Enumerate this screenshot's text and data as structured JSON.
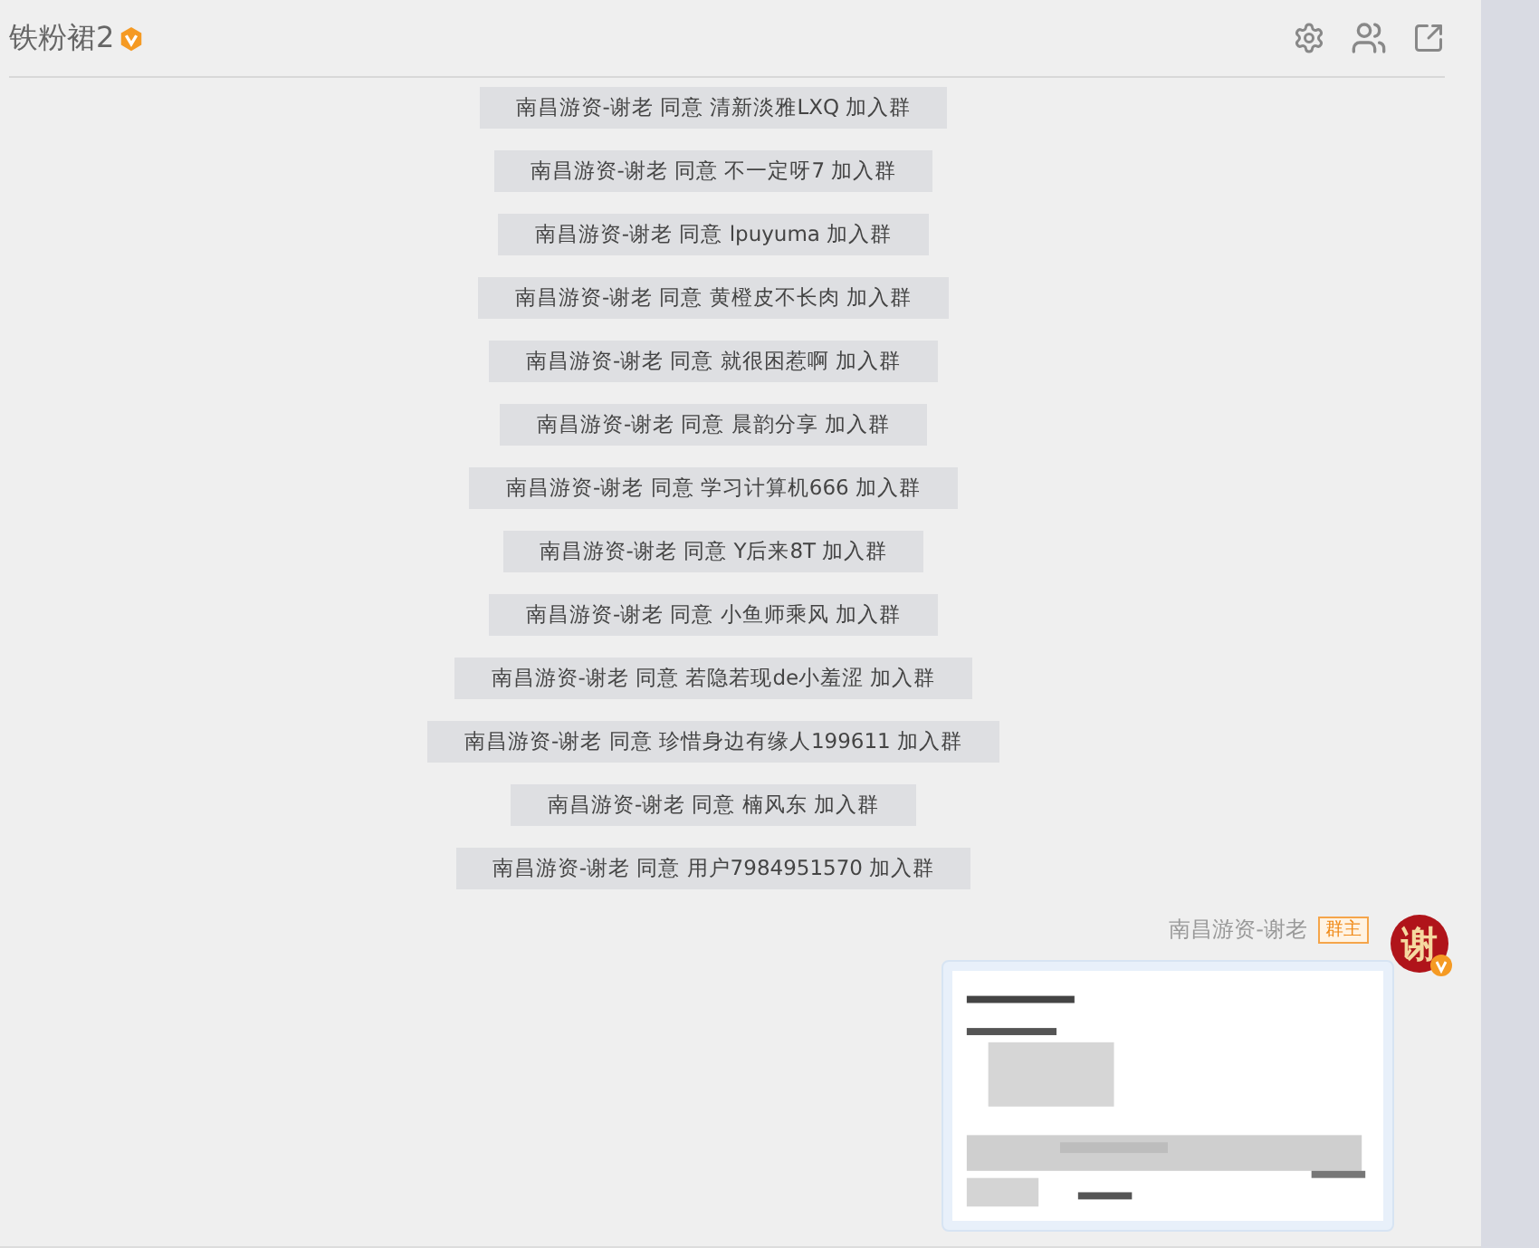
{
  "window": {
    "title": "铁粉裙2"
  },
  "notices": [
    "南昌游资-谢老 同意 清新淡雅LXQ 加入群",
    "南昌游资-谢老 同意 不一定呀7 加入群",
    "南昌游资-谢老 同意 lpuyuma 加入群",
    "南昌游资-谢老 同意 黄橙皮不长肉 加入群",
    "南昌游资-谢老 同意 就很困惹啊 加入群",
    "南昌游资-谢老 同意 晨韵分享 加入群",
    "南昌游资-谢老 同意 学习计算机666 加入群",
    "南昌游资-谢老 同意 Y后来8T 加入群",
    "南昌游资-谢老 同意 小鱼师乘风 加入群",
    "南昌游资-谢老 同意 若隐若现de小羞涩 加入群",
    "南昌游资-谢老 同意 珍惜身边有缘人199611 加入群",
    "南昌游资-谢老 同意 楠风东 加入群",
    "南昌游资-谢老 同意 用户7984951570 加入群"
  ],
  "message": {
    "sender": "南昌游资-谢老",
    "role_badge": "群主",
    "avatar_text": "谢"
  }
}
